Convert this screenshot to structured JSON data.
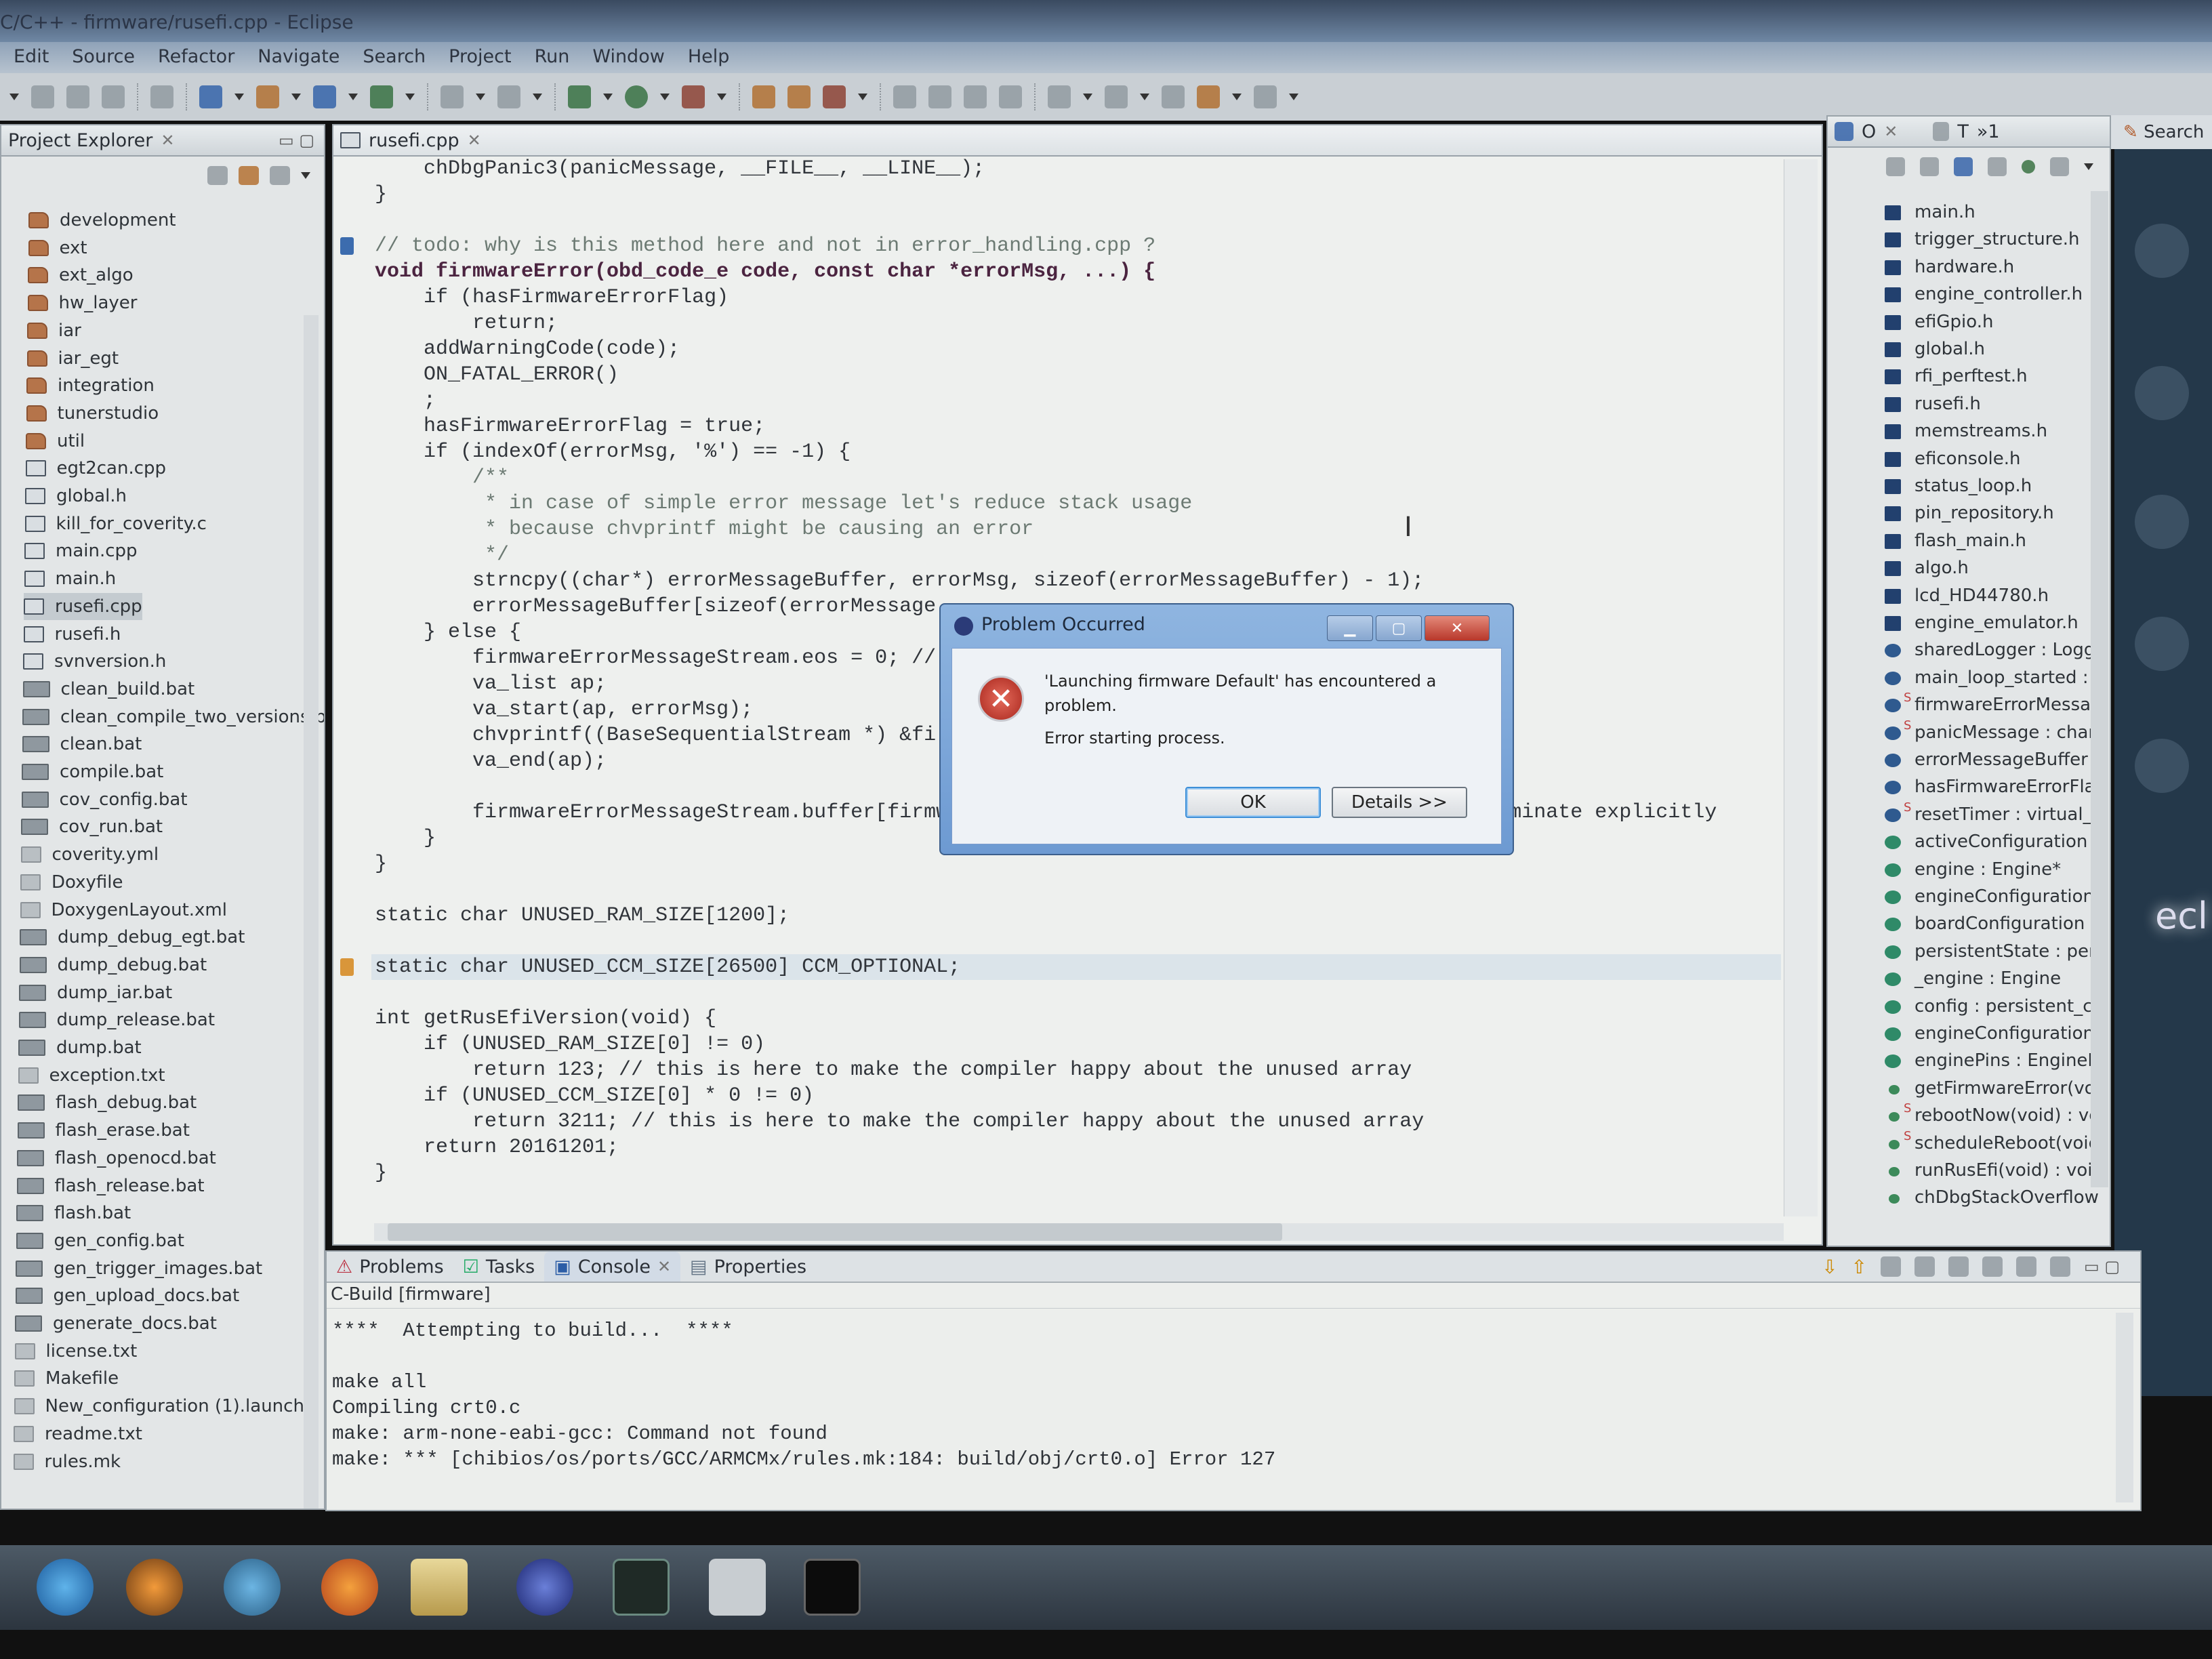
{
  "window": {
    "title": "C/C++ - firmware/rusefi.cpp - Eclipse"
  },
  "menu": [
    "Edit",
    "Source",
    "Refactor",
    "Navigate",
    "Search",
    "Project",
    "Run",
    "Window",
    "Help"
  ],
  "explorer": {
    "title": "Project Explorer",
    "items": [
      {
        "label": "development",
        "type": "folder"
      },
      {
        "label": "ext",
        "type": "folder"
      },
      {
        "label": "ext_algo",
        "type": "folder"
      },
      {
        "label": "hw_layer",
        "type": "folder"
      },
      {
        "label": "iar",
        "type": "folder"
      },
      {
        "label": "iar_egt",
        "type": "folder"
      },
      {
        "label": "integration",
        "type": "folder"
      },
      {
        "label": "tunerstudio",
        "type": "folder"
      },
      {
        "label": "util",
        "type": "folder"
      },
      {
        "label": "egt2can.cpp",
        "type": "c"
      },
      {
        "label": "global.h",
        "type": "h"
      },
      {
        "label": "kill_for_coverity.c",
        "type": "c"
      },
      {
        "label": "main.cpp",
        "type": "c"
      },
      {
        "label": "main.h",
        "type": "h"
      },
      {
        "label": "rusefi.cpp",
        "type": "c",
        "selected": true
      },
      {
        "label": "rusefi.h",
        "type": "h"
      },
      {
        "label": "svnversion.h",
        "type": "h"
      },
      {
        "label": "clean_build.bat",
        "type": "bat"
      },
      {
        "label": "clean_compile_two_versions.ba",
        "type": "bat"
      },
      {
        "label": "clean.bat",
        "type": "bat"
      },
      {
        "label": "compile.bat",
        "type": "bat"
      },
      {
        "label": "cov_config.bat",
        "type": "bat"
      },
      {
        "label": "cov_run.bat",
        "type": "bat"
      },
      {
        "label": "coverity.yml",
        "type": "file"
      },
      {
        "label": "Doxyfile",
        "type": "file"
      },
      {
        "label": "DoxygenLayout.xml",
        "type": "file"
      },
      {
        "label": "dump_debug_egt.bat",
        "type": "bat"
      },
      {
        "label": "dump_debug.bat",
        "type": "bat"
      },
      {
        "label": "dump_iar.bat",
        "type": "bat"
      },
      {
        "label": "dump_release.bat",
        "type": "bat"
      },
      {
        "label": "dump.bat",
        "type": "bat"
      },
      {
        "label": "exception.txt",
        "type": "file"
      },
      {
        "label": "flash_debug.bat",
        "type": "bat"
      },
      {
        "label": "flash_erase.bat",
        "type": "bat"
      },
      {
        "label": "flash_openocd.bat",
        "type": "bat"
      },
      {
        "label": "flash_release.bat",
        "type": "bat"
      },
      {
        "label": "flash.bat",
        "type": "bat"
      },
      {
        "label": "gen_config.bat",
        "type": "bat"
      },
      {
        "label": "gen_trigger_images.bat",
        "type": "bat"
      },
      {
        "label": "gen_upload_docs.bat",
        "type": "bat"
      },
      {
        "label": "generate_docs.bat",
        "type": "bat"
      },
      {
        "label": "license.txt",
        "type": "file"
      },
      {
        "label": "Makefile",
        "type": "file"
      },
      {
        "label": "New_configuration (1).launch",
        "type": "file"
      },
      {
        "label": "readme.txt",
        "type": "file"
      },
      {
        "label": "rules.mk",
        "type": "file"
      }
    ]
  },
  "editor": {
    "tab": "rusefi.cpp",
    "lines": [
      {
        "t": "    chDbgPanic3(panicMessage, __FILE__, __LINE__);"
      },
      {
        "t": "}"
      },
      {
        "t": ""
      },
      {
        "t": "// todo: why is this method here and not in error_handling.cpp ?",
        "c": "cm",
        "marker": "task"
      },
      {
        "t": "void firmwareError(obd_code_e code, const char *errorMsg, ...) {",
        "c": "kw"
      },
      {
        "t": "    if (hasFirmwareErrorFlag)"
      },
      {
        "t": "        return;"
      },
      {
        "t": "    addWarningCode(code);"
      },
      {
        "t": "    ON_FATAL_ERROR()"
      },
      {
        "t": "    ;"
      },
      {
        "t": "    hasFirmwareErrorFlag = true;"
      },
      {
        "t": "    if (indexOf(errorMsg, '%') == -1) {"
      },
      {
        "t": "        /**",
        "c": "cm"
      },
      {
        "t": "         * in case of simple error message let's reduce stack usage",
        "c": "cm"
      },
      {
        "t": "         * because chvprintf might be causing an error",
        "c": "cm"
      },
      {
        "t": "         */",
        "c": "cm"
      },
      {
        "t": "        strncpy((char*) errorMessageBuffer, errorMsg, sizeof(errorMessageBuffer) - 1);"
      },
      {
        "t": "        errorMessageBuffer[sizeof(errorMessage"
      },
      {
        "t": "    } else {"
      },
      {
        "t": "        firmwareErrorMessageStream.eos = 0; //"
      },
      {
        "t": "        va_list ap;"
      },
      {
        "t": "        va_start(ap, errorMsg);"
      },
      {
        "t": "        chvprintf((BaseSequentialStream *) &fi"
      },
      {
        "t": "        va_end(ap);"
      },
      {
        "t": ""
      },
      {
        "t": "        firmwareErrorMessageStream.buffer[firmwareErrorMessageStream.eos] = 0; // need to terminate explicitly"
      },
      {
        "t": "    }"
      },
      {
        "t": "}"
      },
      {
        "t": ""
      },
      {
        "t": "static char UNUSED_RAM_SIZE[1200];"
      },
      {
        "t": ""
      },
      {
        "t": "static char UNUSED_CCM_SIZE[26500] CCM_OPTIONAL;",
        "hl": true,
        "marker": "warning"
      },
      {
        "t": ""
      },
      {
        "t": "int getRusEfiVersion(void) {"
      },
      {
        "t": "    if (UNUSED_RAM_SIZE[0] != 0)"
      },
      {
        "t": "        return 123; // this is here to make the compiler happy about the unused array"
      },
      {
        "t": "    if (UNUSED_CCM_SIZE[0] * 0 != 0)"
      },
      {
        "t": "        return 3211; // this is here to make the compiler happy about the unused array"
      },
      {
        "t": "    return 20161201;"
      },
      {
        "t": "}"
      }
    ]
  },
  "outline": {
    "tab": "O",
    "tab2": "T",
    "tab3": "»1",
    "items": [
      {
        "label": "main.h",
        "icon": "h"
      },
      {
        "label": "trigger_structure.h",
        "icon": "h"
      },
      {
        "label": "hardware.h",
        "icon": "h"
      },
      {
        "label": "engine_controller.h",
        "icon": "h"
      },
      {
        "label": "efiGpio.h",
        "icon": "h"
      },
      {
        "label": "global.h",
        "icon": "h"
      },
      {
        "label": "rfi_perftest.h",
        "icon": "h"
      },
      {
        "label": "rusefi.h",
        "icon": "h"
      },
      {
        "label": "memstreams.h",
        "icon": "h"
      },
      {
        "label": "eficonsole.h",
        "icon": "h"
      },
      {
        "label": "status_loop.h",
        "icon": "h"
      },
      {
        "label": "pin_repository.h",
        "icon": "h"
      },
      {
        "label": "flash_main.h",
        "icon": "h"
      },
      {
        "label": "algo.h",
        "icon": "h"
      },
      {
        "label": "lcd_HD44780.h",
        "icon": "h"
      },
      {
        "label": "engine_emulator.h",
        "icon": "h"
      },
      {
        "label": "sharedLogger : Loggi",
        "icon": "fb"
      },
      {
        "label": "main_loop_started : b",
        "icon": "fb"
      },
      {
        "label": "firmwareErrorMessag",
        "icon": "fb",
        "static": true
      },
      {
        "label": "panicMessage : char[",
        "icon": "fb",
        "static": true
      },
      {
        "label": "errorMessageBuffer :",
        "icon": "fb"
      },
      {
        "label": "hasFirmwareErrorFlag",
        "icon": "fb"
      },
      {
        "label": "resetTimer : virtual_ti",
        "icon": "fb",
        "static": true
      },
      {
        "label": "activeConfiguration :",
        "icon": "fg"
      },
      {
        "label": "engine : Engine*",
        "icon": "fg"
      },
      {
        "label": "engineConfiguration",
        "icon": "fg"
      },
      {
        "label": "boardConfiguration :",
        "icon": "fg"
      },
      {
        "label": "persistentState : persi",
        "icon": "fg"
      },
      {
        "label": "_engine : Engine",
        "icon": "fg"
      },
      {
        "label": "config : persistent_cc",
        "icon": "fg"
      },
      {
        "label": "engineConfiguration",
        "icon": "fg"
      },
      {
        "label": "enginePins : EngineP",
        "icon": "fg"
      },
      {
        "label": "getFirmwareError(voi",
        "icon": "m"
      },
      {
        "label": "rebootNow(void) : vc",
        "icon": "m",
        "static": true
      },
      {
        "label": "scheduleReboot(voic",
        "icon": "m",
        "static": true
      },
      {
        "label": "runRusEfi(void) : voic",
        "icon": "m"
      },
      {
        "label": "chDbgStackOverflow",
        "icon": "m"
      }
    ]
  },
  "search_tab": "Search",
  "welcome_logo": "ecl",
  "console": {
    "tabs": [
      "Problems",
      "Tasks",
      "Console",
      "Properties"
    ],
    "active_tab": "Console",
    "header": "C-Build [firmware]",
    "lines": [
      "****  Attempting to build...  ****",
      "",
      "make all",
      "Compiling crt0.c",
      "make: arm-none-eabi-gcc: Command not found",
      "make: *** [chibios/os/ports/GCC/ARMCMx/rules.mk:184: build/obj/crt0.o] Error 127"
    ]
  },
  "dialog": {
    "title": "Problem Occurred",
    "message": "'Launching firmware Default' has encountered a problem.",
    "detail": "Error starting process.",
    "ok": "OK",
    "details": "Details >>"
  },
  "taskbar": {
    "apps": [
      "internet-explorer",
      "media-player",
      "chrome",
      "firefox",
      "file-explorer",
      "eclipse",
      "terminal-app",
      "blank-window",
      "cmd"
    ]
  }
}
